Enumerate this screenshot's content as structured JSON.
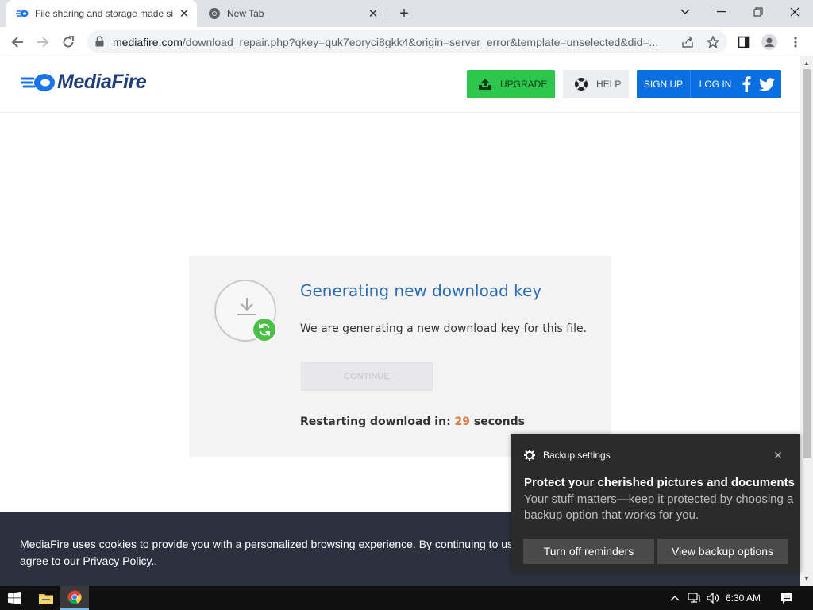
{
  "browser": {
    "tabs": [
      {
        "title": "File sharing and storage made si",
        "active": true
      },
      {
        "title": "New Tab",
        "active": false
      }
    ],
    "url_domain": "mediafire.com",
    "url_path": "/download_repair.php?qkey=quk7eoryci8gkk4&origin=server_error&template=unselected&did=..."
  },
  "header": {
    "logo_text": "MediaFire",
    "upgrade_label": "UPGRADE",
    "help_label": "HELP",
    "signup_label": "SIGN UP",
    "login_label": "LOG IN"
  },
  "download": {
    "title": "Generating new download key",
    "description": "We are generating a new download key for this file.",
    "continue_label": "CONTINUE",
    "restart_prefix": "Restarting download in:",
    "restart_seconds": "29",
    "restart_suffix": "seconds"
  },
  "cookie": {
    "line1": "MediaFire uses cookies to provide you with a personalized browsing experience. By continuing to use t",
    "line2": "agree to our Privacy Policy.."
  },
  "toast": {
    "app": "Backup settings",
    "title": "Protect your cherished pictures and documents",
    "body": "Your stuff matters—keep it protected by choosing a backup option that works for you.",
    "button1": "Turn off reminders",
    "button2": "View backup options"
  },
  "taskbar": {
    "time": "6:30 AM"
  },
  "colors": {
    "brand_blue": "#0a6fe0",
    "upgrade_green": "#2cc64c",
    "title_blue": "#2d6db5",
    "countdown_orange": "#e07a3c",
    "cookie_bg": "#2c3140",
    "toast_bg": "#2b2b2b"
  }
}
